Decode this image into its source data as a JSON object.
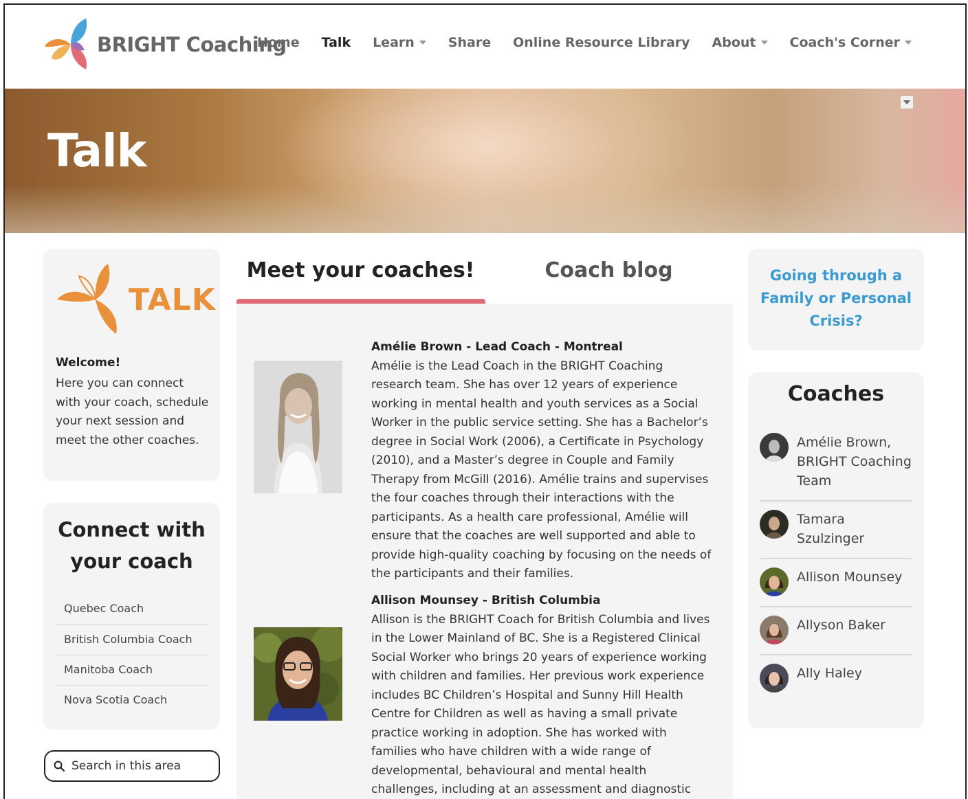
{
  "header": {
    "brand": "BRIGHT Coaching",
    "nav": [
      {
        "label": "Home",
        "active": false,
        "dropdown": false
      },
      {
        "label": "Talk",
        "active": true,
        "dropdown": false
      },
      {
        "label": "Learn",
        "active": false,
        "dropdown": true
      },
      {
        "label": "Share",
        "active": false,
        "dropdown": false
      },
      {
        "label": "Online Resource Library",
        "active": false,
        "dropdown": false
      },
      {
        "label": "About",
        "active": false,
        "dropdown": true
      },
      {
        "label": "Coach's Corner",
        "active": false,
        "dropdown": true
      }
    ]
  },
  "hero": {
    "title": "Talk"
  },
  "sidebar_left": {
    "talk_logo_text": "TALK",
    "welcome_heading": "Welcome!",
    "welcome_text": "Here you can connect with your coach, schedule your next session and meet the other coaches.",
    "connect_title_1": "Connect with",
    "connect_title_2": "your coach",
    "connect_items": [
      "Quebec Coach",
      "British Columbia Coach",
      "Manitoba Coach",
      "Nova Scotia Coach"
    ],
    "search_placeholder": "Search in this area"
  },
  "tabs": {
    "meet": "Meet your coaches!",
    "blog": "Coach blog"
  },
  "coaches": [
    {
      "name": "Amélie Brown - Lead Coach - Montreal",
      "bio": "Amélie is the Lead Coach in the BRIGHT Coaching research team. She has over 12 years of experience working in mental health and youth services as a Social Worker in the public service setting. She has a Bachelor’s degree in Social Work (2006), a Certificate in Psychology (2010), and a Master’s degree in Couple and Family Therapy from McGill (2016). Amélie trains and supervises the four coaches through their interactions with the participants. As a health care professional, Amélie will ensure that the coaches are well supported and able to provide high-quality coaching by focusing on the needs of the participants and their families."
    },
    {
      "name": "Allison Mounsey - British Columbia",
      "bio": "Allison is the BRIGHT Coach for British Columbia and lives in the Lower Mainland of BC. She is a Registered Clinical Social Worker who brings 20 years of experience working with children and families. Her previous work experience includes BC Children’s Hospital and Sunny Hill Health Centre for Children as well as having a small private practice working in adoption. She has worked with families who have children with a wide range of developmental, behavioural and mental health challenges, including at an assessment and diagnostic clinic for children with developmental disabilities."
    }
  ],
  "sidebar_right": {
    "crisis_link": "Going through a Family or Personal Crisis?",
    "coaches_title": "Coaches",
    "coach_list": [
      "Amélie Brown, BRIGHT Coaching Team",
      "Tamara Szulzinger",
      "Allison Mounsey",
      "Allyson Baker",
      "Ally Haley"
    ]
  },
  "colors": {
    "accent_pink": "#e26b78",
    "accent_orange": "#e8903a",
    "link_blue": "#3b9ad0",
    "card_bg": "#f4f4f4"
  }
}
